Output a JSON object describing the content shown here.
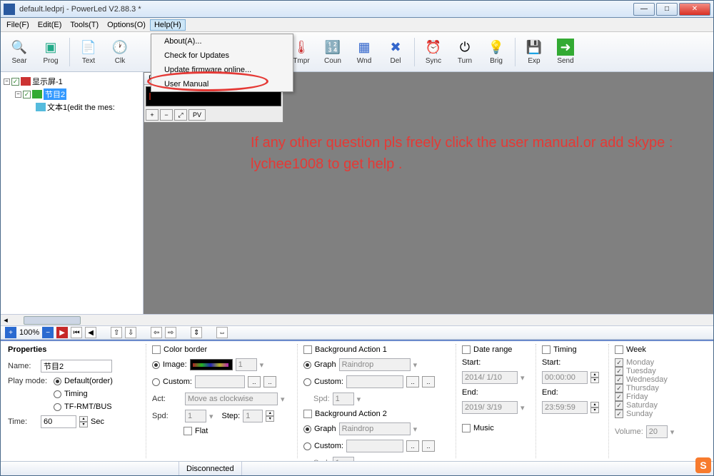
{
  "title": "default.ledprj - PowerLed V2.88.3 *",
  "menus": {
    "file": "File(F)",
    "edit": "Edit(E)",
    "tools": "Tools(T)",
    "options": "Options(O)",
    "help": "Help(H)"
  },
  "help_dd": {
    "about": "About(A)...",
    "check": "Check for Updates",
    "fw": "Update firmware online...",
    "manual": "User Manual"
  },
  "tb": {
    "sear": "Sear",
    "prog": "Prog",
    "text": "Text",
    "clk": "Clk",
    "tmpr": "Tmpr",
    "coun": "Coun",
    "wnd": "Wnd",
    "del": "Del",
    "sync": "Sync",
    "turn": "Turn",
    "brig": "Brig",
    "exp": "Exp",
    "send": "Send"
  },
  "tree": {
    "root": "显示屏-1",
    "prog": "节目2",
    "text": "文本1(edit the mes:"
  },
  "preview_hd": "Previ",
  "zoom": "100%",
  "hint": "If any other question pls freely click the user manual.or add skype : lychee1008 to get help .",
  "props": {
    "hdr": "Properties",
    "name_lbl": "Name:",
    "name_val": "节目2",
    "play_lbl": "Play mode:",
    "play_default": "Default(order)",
    "play_timing": "Timing",
    "play_tf": "TF-RMT/BUS",
    "time_lbl": "Time:",
    "time_val": "60",
    "time_unit": "Sec",
    "cb_lbl": "Color border",
    "image": "Image:",
    "image_n": "1",
    "custom": "Custom:",
    "act": "Act:",
    "act_val": "Move as clockwise",
    "spd": "Spd:",
    "spd_val": "1",
    "step": "Step:",
    "step_val": "1",
    "flat": "Flat",
    "bg1": "Background Action 1",
    "bg2": "Background Action 2",
    "graph": "Graph",
    "graph_val": "Raindrop",
    "dr": "Date range",
    "start": "Start:",
    "end": "End:",
    "d1": "2014/ 1/10",
    "d2": "2019/ 3/19",
    "tm": "Timing",
    "t1": "00:00:00",
    "t2": "23:59:59",
    "music": "Music",
    "wk": "Week",
    "days": [
      "Monday",
      "Tuesday",
      "Wednesday",
      "Thursday",
      "Friday",
      "Saturday",
      "Sunday"
    ],
    "vol": "Volume:",
    "vol_val": "20"
  },
  "status": "Disconnected"
}
